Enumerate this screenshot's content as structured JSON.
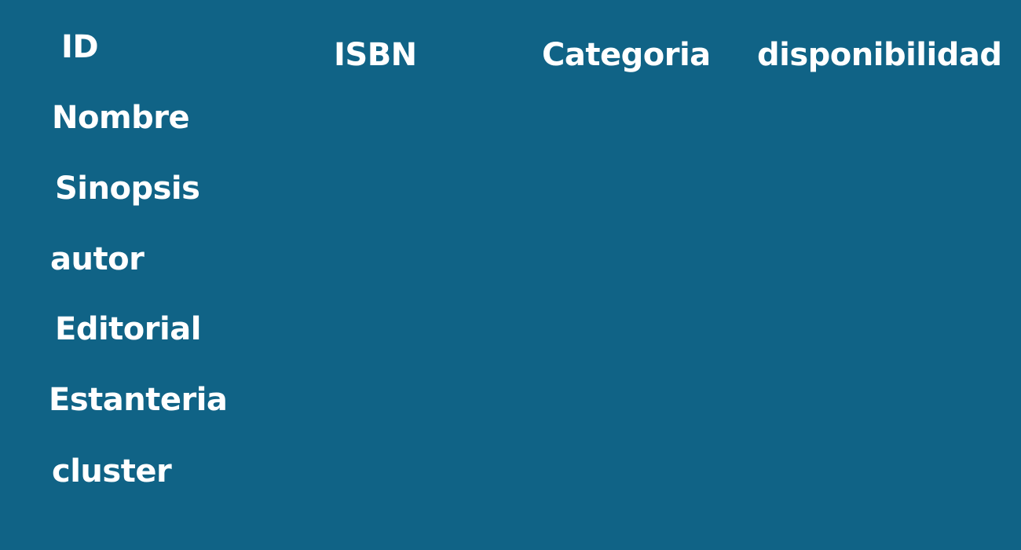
{
  "fields": {
    "id": "ID",
    "nombre": "Nombre",
    "sinopsis": "Sinopsis",
    "autor": "autor",
    "editorial": "Editorial",
    "estanteria": "Estanteria",
    "cluster": "cluster",
    "isbn": "ISBN",
    "categoria": "Categoria",
    "disponibilidad": "disponibilidad"
  },
  "colors": {
    "background": "#106386",
    "text": "#ffffff"
  }
}
